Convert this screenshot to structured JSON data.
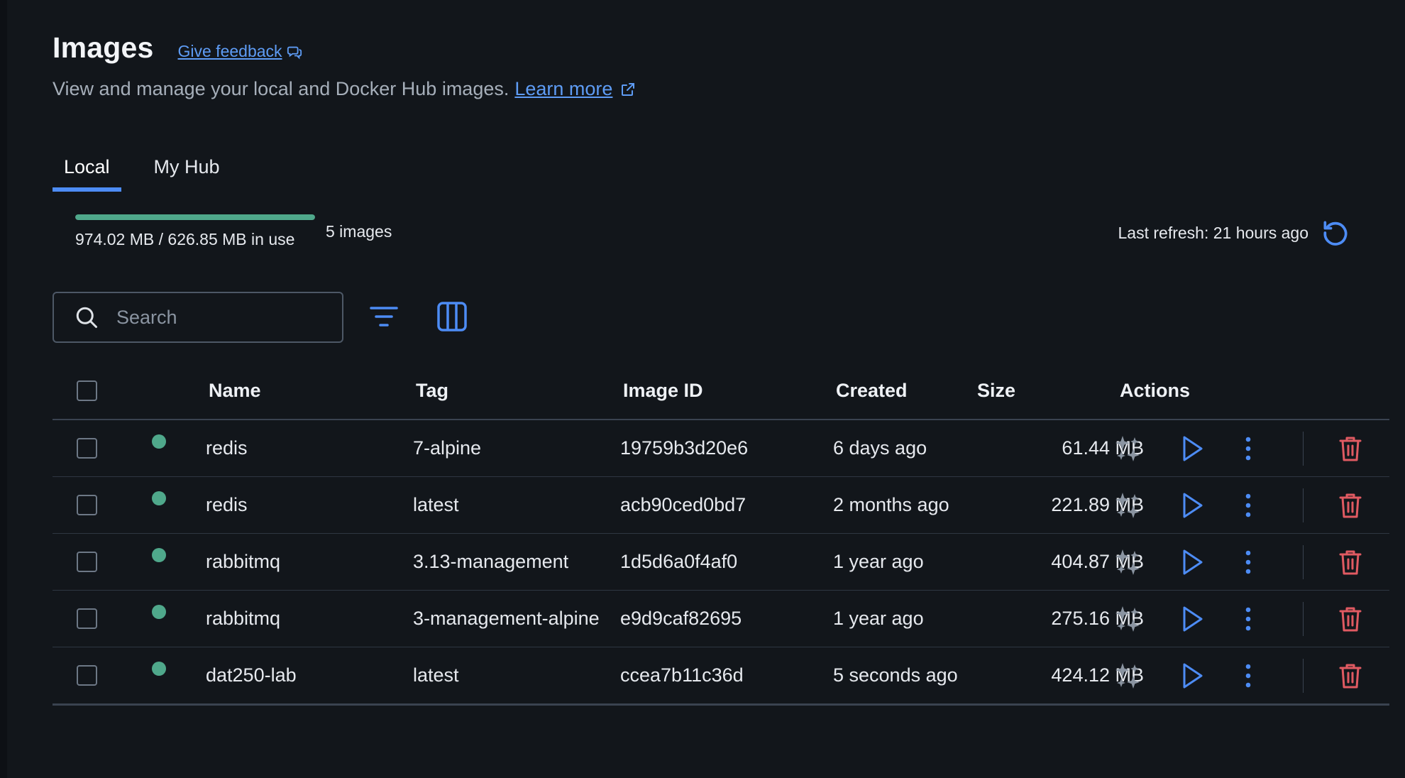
{
  "header": {
    "title": "Images",
    "feedback_label": "Give feedback",
    "subtitle": "View and manage your local and Docker Hub images.",
    "learn_more_label": "Learn more"
  },
  "tabs": [
    {
      "label": "Local",
      "active": true
    },
    {
      "label": "My Hub",
      "active": false
    }
  ],
  "usage": {
    "text": "974.02 MB / 626.85 MB in use",
    "fill_fraction": 1.0,
    "bar_color": "#4fa88b",
    "count_label": "5 images"
  },
  "refresh": {
    "label": "Last refresh: 21 hours ago",
    "icon": "refresh-icon"
  },
  "toolbar": {
    "search_placeholder": "Search",
    "filter_icon": "filter-icon",
    "columns_icon": "columns-icon"
  },
  "table": {
    "columns": {
      "name": "Name",
      "tag": "Tag",
      "image_id": "Image ID",
      "created": "Created",
      "size": "Size",
      "actions": "Actions"
    },
    "rows": [
      {
        "name": "redis",
        "tag": "7-alpine",
        "image_id": "19759b3d20e6",
        "created": "6 days ago",
        "size": "61.44 MB",
        "in_use": true
      },
      {
        "name": "redis",
        "tag": "latest",
        "image_id": "acb90ced0bd7",
        "created": "2 months ago",
        "size": "221.89 MB",
        "in_use": true
      },
      {
        "name": "rabbitmq",
        "tag": "3.13-management",
        "image_id": "1d5d6a0f4af0",
        "created": "1 year ago",
        "size": "404.87 MB",
        "in_use": true
      },
      {
        "name": "rabbitmq",
        "tag": "3-management-alpine",
        "image_id": "e9d9caf82695",
        "created": "1 year ago",
        "size": "275.16 MB",
        "in_use": true
      },
      {
        "name": "dat250-lab",
        "tag": "latest",
        "image_id": "ccea7b11c36d",
        "created": "5 seconds ago",
        "size": "424.12 MB",
        "in_use": true
      }
    ]
  },
  "colors": {
    "accent": "#4d8cf5",
    "link": "#5e9cf5",
    "in_use": "#4fa88b",
    "danger": "#e05a62",
    "background": "#12161b"
  }
}
